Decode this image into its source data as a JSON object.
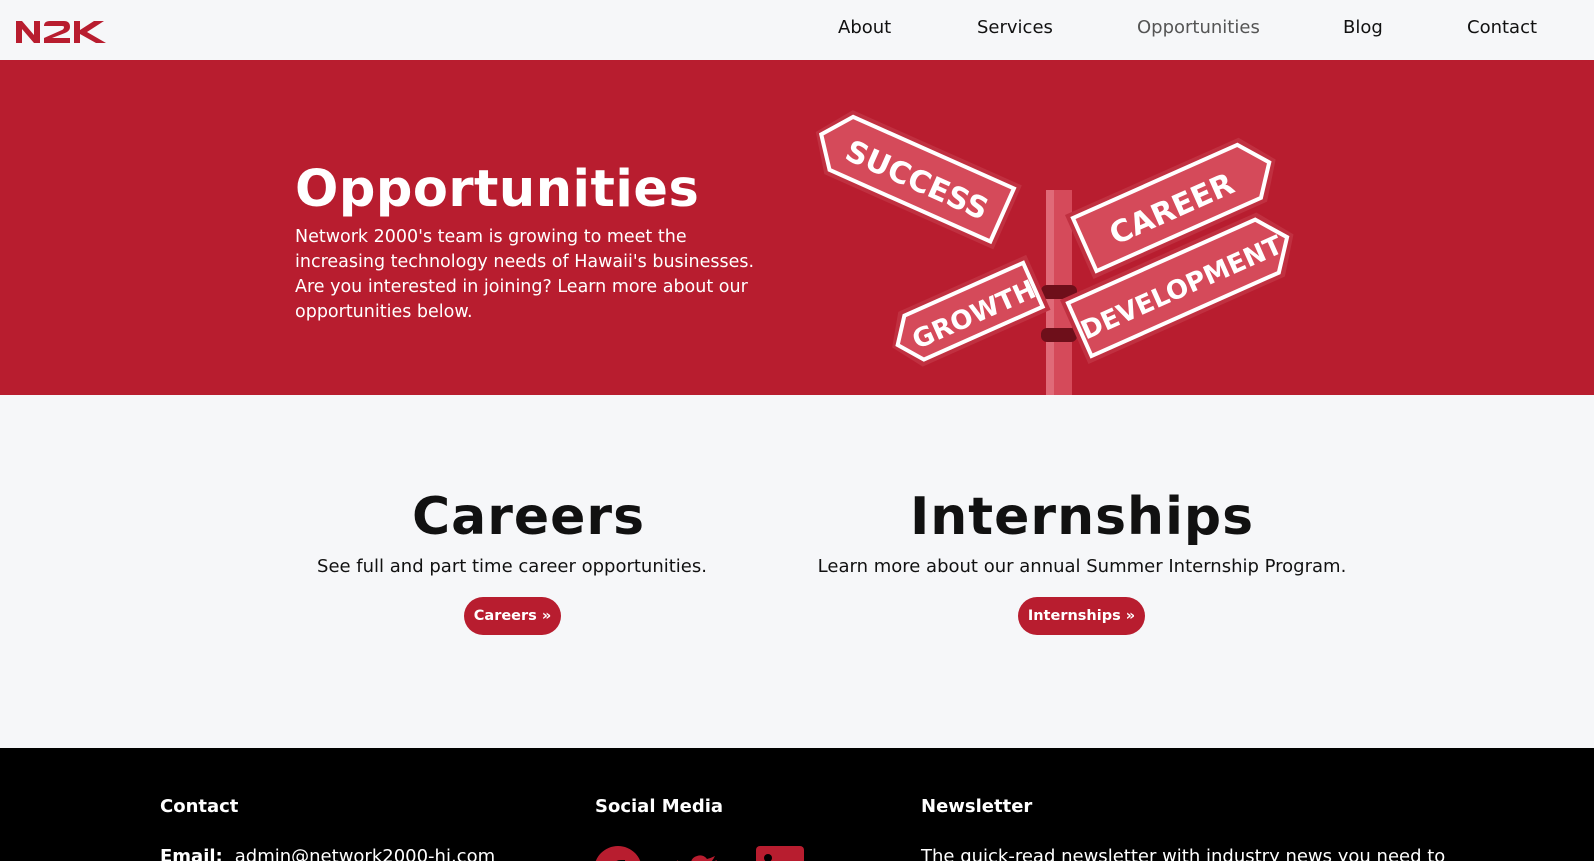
{
  "brand": {
    "logo_text": "N2K",
    "accent": "#b81d2f"
  },
  "nav": {
    "items": [
      {
        "label": "About",
        "active": false
      },
      {
        "label": "Services",
        "active": false
      },
      {
        "label": "Opportunities",
        "active": true
      },
      {
        "label": "Blog",
        "active": false
      },
      {
        "label": "Contact",
        "active": false
      }
    ]
  },
  "hero": {
    "title": "Opportunities",
    "text": "Network 2000's team is growing to meet the increasing technology needs of Hawaii's businesses. Are you interested in joining? Learn more about our opportunities below.",
    "sign_labels": [
      "SUCCESS",
      "CAREER",
      "GROWTH",
      "DEVELOPMENT"
    ]
  },
  "cards": [
    {
      "title": "Careers",
      "text": "See full and part time career opportunities.",
      "button": "Careers »"
    },
    {
      "title": "Internships",
      "text": "Learn more about our annual Summer Internship Program.",
      "button": "Internships »"
    }
  ],
  "footer": {
    "contact_heading": "Contact",
    "social_heading": "Social Media",
    "newsletter_heading": "Newsletter",
    "email_label": "Email:",
    "email_value": "admin@network2000-hi.com",
    "newsletter_text": "The quick-read newsletter with industry news you need to",
    "social_icons": [
      "facebook-icon",
      "twitter-icon",
      "linkedin-icon"
    ]
  }
}
